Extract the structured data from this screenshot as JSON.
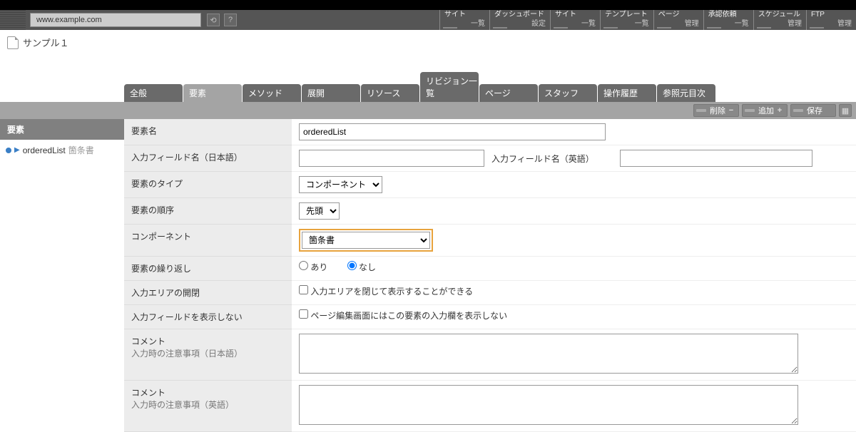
{
  "url": "www.example.com",
  "pageTitle": "サンプル１",
  "globalNav": [
    {
      "title": "サイト",
      "sub": "一覧"
    },
    {
      "title": "ダッシュボード",
      "sub": "設定"
    },
    {
      "title": "サイト",
      "sub": "一覧"
    },
    {
      "title": "テンプレート",
      "sub": "一覧"
    },
    {
      "title": "ページ",
      "sub": "管理"
    },
    {
      "title": "承認依頼",
      "sub": "一覧"
    },
    {
      "title": "スケジュール",
      "sub": "管理"
    },
    {
      "title": "FTP",
      "sub": "管理"
    }
  ],
  "tabs": [
    "全般",
    "要素",
    "メソッド",
    "展開",
    "リソース",
    "リビジョン一覧",
    "ページ",
    "スタッフ",
    "操作履歴",
    "参照元目次"
  ],
  "activeTab": 1,
  "actions": {
    "delete": "削除",
    "add": "追加",
    "save": "保存"
  },
  "sidebar": {
    "header": "要素",
    "item": {
      "code": "orderedList",
      "label": "箇条書"
    }
  },
  "form": {
    "nameLabel": "要素名",
    "nameValue": "orderedList",
    "fieldJpLabel": "入力フィールド名（日本語）",
    "fieldJpValue": "",
    "fieldEnLabel": "入力フィールド名（英語）",
    "fieldEnValue": "",
    "typeLabel": "要素のタイプ",
    "typeValue": "コンポーネント",
    "orderLabel": "要素の順序",
    "orderValue": "先頭",
    "componentLabel": "コンポーネント",
    "componentValue": "箇条書",
    "repeatLabel": "要素の繰り返し",
    "repeatYes": "あり",
    "repeatNo": "なし",
    "collapseLabel": "入力エリアの開閉",
    "collapseText": "入力エリアを閉じて表示することができる",
    "hideLabel": "入力フィールドを表示しない",
    "hideText": "ページ編集画面にはこの要素の入力欄を表示しない",
    "commentJpLabel1": "コメント",
    "commentJpLabel2": "入力時の注意事項（日本語）",
    "commentJpValue": "",
    "commentEnLabel1": "コメント",
    "commentEnLabel2": "入力時の注意事項（英語）",
    "commentEnValue": ""
  }
}
